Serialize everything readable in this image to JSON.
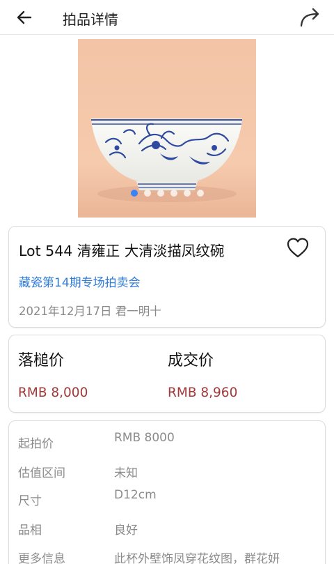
{
  "header": {
    "title": "拍品详情"
  },
  "gallery": {
    "image_count": 6,
    "active_index": 0
  },
  "lot": {
    "title": "Lot 544 清雍正 大清淡描凤纹碗",
    "auction_name": "藏瓷第14期专场拍卖会",
    "date_line": "2021年12月17日 君一明十"
  },
  "prices": {
    "hammer_label": "落槌价",
    "hammer_value": "RMB 8,000",
    "deal_label": "成交价",
    "deal_value": "RMB 8,960"
  },
  "details": [
    {
      "key": "起拍价",
      "value": "RMB 8000"
    },
    {
      "key": "估值区间",
      "value": "未知"
    },
    {
      "key": "尺寸",
      "value": "D12cm"
    },
    {
      "key": "品相",
      "value": "良好"
    },
    {
      "key": "更多信息",
      "value": "此杯外壁饰凤穿花纹图，群花妍"
    }
  ],
  "colors": {
    "accent_blue": "#2f7bd8",
    "price_red": "#a23a3a",
    "dot_active": "#3b82f6"
  }
}
